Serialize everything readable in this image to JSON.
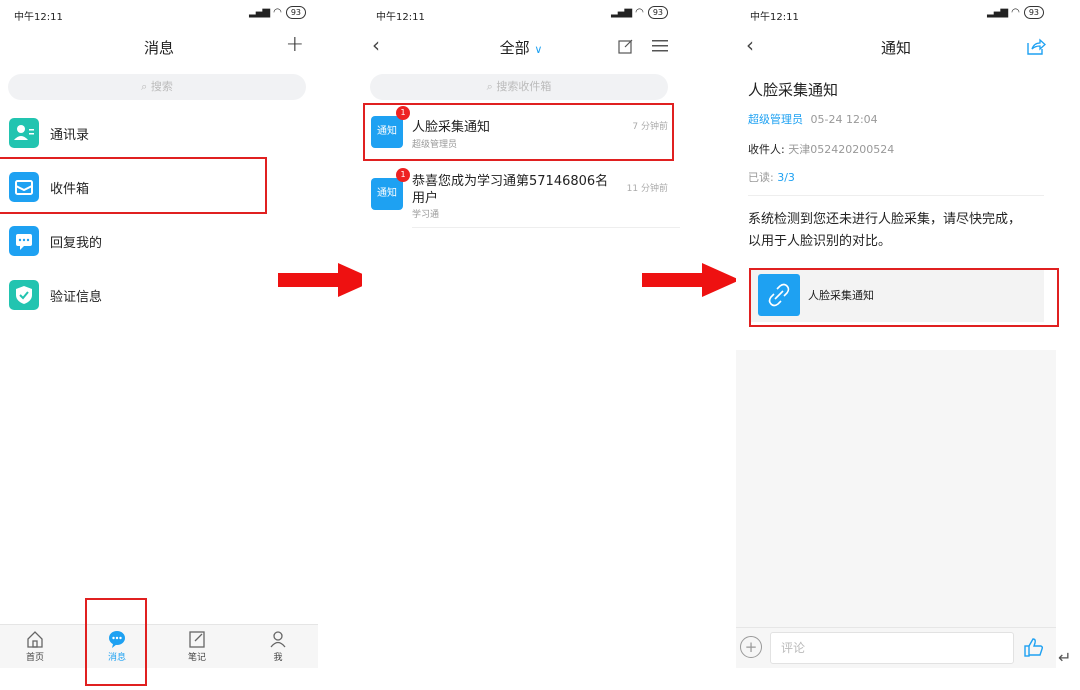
{
  "status": {
    "time": "中午12:11",
    "battery": "93"
  },
  "screen1": {
    "title": "消息",
    "search_placeholder": "搜索",
    "items": [
      {
        "label": "通讯录"
      },
      {
        "label": "收件箱"
      },
      {
        "label": "回复我的"
      },
      {
        "label": "验证信息"
      }
    ],
    "tabs": [
      {
        "label": "首页"
      },
      {
        "label": "消息"
      },
      {
        "label": "笔记"
      },
      {
        "label": "我"
      }
    ]
  },
  "screen2": {
    "title": "全部",
    "search_placeholder": "搜索收件箱",
    "messages": [
      {
        "icon_text": "通知",
        "badge": "1",
        "title": "人脸采集通知",
        "sender": "超级管理员",
        "time": "7 分钟前"
      },
      {
        "icon_text": "通知",
        "badge": "1",
        "title_line1": "恭喜您成为学习通第57146806名",
        "title_line2": "用户",
        "sender": "学习通",
        "time": "11 分钟前"
      }
    ]
  },
  "screen3": {
    "title": "通知",
    "heading": "人脸采集通知",
    "sender": "超级管理员",
    "datetime": "05-24 12:04",
    "recipient_label": "收件人:",
    "recipient_value": "天津052420200524",
    "read_label": "已读:",
    "read_value": "3/3",
    "body_line1": "系统检测到您还未进行人脸采集，请尽快完成，",
    "body_line2": "以用于人脸识别的对比。",
    "attachment_label": "人脸采集通知",
    "comment_placeholder": "评论"
  },
  "colors": {
    "accent": "#1ea1f2",
    "highlight_red": "#e02020",
    "arrow_red": "#ee1111"
  }
}
